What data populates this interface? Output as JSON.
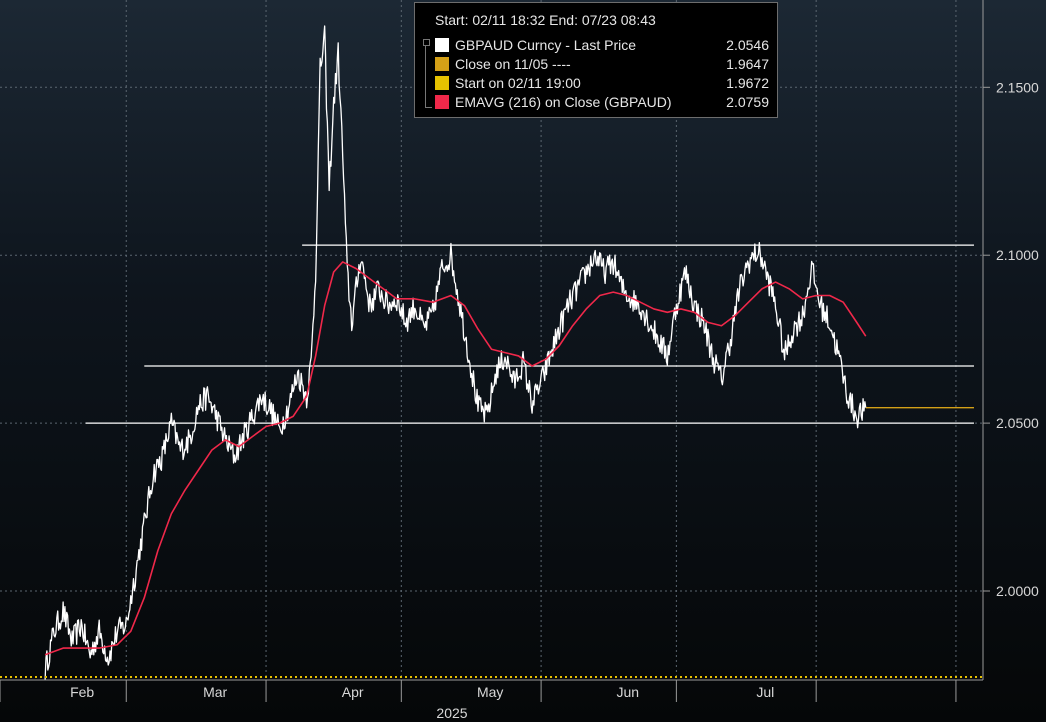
{
  "chart_data": {
    "type": "line",
    "title": "",
    "x_axis": {
      "month_labels": [
        "Feb",
        "Mar",
        "Apr",
        "May",
        "Jun",
        "Jul"
      ],
      "year_label": "2025",
      "range": [
        "2025-02-11",
        "2025-07-23"
      ]
    },
    "y_axis": {
      "ticks": [
        "2.1500",
        "2.1000",
        "2.0500",
        "2.0000"
      ],
      "range": [
        1.9735,
        2.176
      ],
      "side": "right"
    },
    "grid": true,
    "legend": {
      "placement": "top-center",
      "header": "Start: 02/11 18:32 End: 07/23 08:43",
      "entries": [
        {
          "name": "GBPAUD Curncy - Last Price",
          "value": "2.0546",
          "color": "#ffffff"
        },
        {
          "name": "Close on 11/05 ----",
          "value": "1.9647",
          "color": "#d4a017"
        },
        {
          "name": "Start on 02/11 19:00",
          "value": "1.9672",
          "color": "#e6c200"
        },
        {
          "name": "EMAVG (216)  on Close (GBPAUD)",
          "value": "2.0759",
          "color": "#f0284a"
        }
      ]
    },
    "series": [
      {
        "name": "GBPAUD Curncy - Last Price",
        "color": "#ffffff",
        "points": [
          [
            "2025-02-11",
            1.9765
          ],
          [
            "2025-02-13",
            1.988
          ],
          [
            "2025-02-15",
            1.994
          ],
          [
            "2025-02-17",
            1.985
          ],
          [
            "2025-02-19",
            1.99
          ],
          [
            "2025-02-21",
            1.981
          ],
          [
            "2025-02-23",
            1.988
          ],
          [
            "2025-02-25",
            1.98
          ],
          [
            "2025-02-27",
            1.988
          ],
          [
            "2025-03-01",
            1.99
          ],
          [
            "2025-03-03",
            2.005
          ],
          [
            "2025-03-05",
            2.02
          ],
          [
            "2025-03-07",
            2.035
          ],
          [
            "2025-03-09",
            2.04
          ],
          [
            "2025-03-11",
            2.05
          ],
          [
            "2025-03-13",
            2.042
          ],
          [
            "2025-03-15",
            2.045
          ],
          [
            "2025-03-17",
            2.055
          ],
          [
            "2025-03-19",
            2.058
          ],
          [
            "2025-03-21",
            2.052
          ],
          [
            "2025-03-23",
            2.045
          ],
          [
            "2025-03-25",
            2.04
          ],
          [
            "2025-03-27",
            2.046
          ],
          [
            "2025-03-29",
            2.052
          ],
          [
            "2025-03-31",
            2.058
          ],
          [
            "2025-04-02",
            2.054
          ],
          [
            "2025-04-04",
            2.048
          ],
          [
            "2025-04-06",
            2.055
          ],
          [
            "2025-04-08",
            2.065
          ],
          [
            "2025-04-10",
            2.058
          ],
          [
            "2025-04-11",
            2.068
          ],
          [
            "2025-04-12",
            2.095
          ],
          [
            "2025-04-13",
            2.155
          ],
          [
            "2025-04-14",
            2.165
          ],
          [
            "2025-04-15",
            2.12
          ],
          [
            "2025-04-16",
            2.145
          ],
          [
            "2025-04-17",
            2.16
          ],
          [
            "2025-04-18",
            2.13
          ],
          [
            "2025-04-19",
            2.095
          ],
          [
            "2025-04-20",
            2.08
          ],
          [
            "2025-04-22",
            2.1
          ],
          [
            "2025-04-24",
            2.085
          ],
          [
            "2025-04-26",
            2.09
          ],
          [
            "2025-04-28",
            2.085
          ],
          [
            "2025-04-30",
            2.087
          ],
          [
            "2025-05-02",
            2.08
          ],
          [
            "2025-05-04",
            2.085
          ],
          [
            "2025-05-06",
            2.078
          ],
          [
            "2025-05-08",
            2.083
          ],
          [
            "2025-05-10",
            2.096
          ],
          [
            "2025-05-12",
            2.1
          ],
          [
            "2025-05-14",
            2.085
          ],
          [
            "2025-05-16",
            2.07
          ],
          [
            "2025-05-18",
            2.055
          ],
          [
            "2025-05-20",
            2.052
          ],
          [
            "2025-05-22",
            2.065
          ],
          [
            "2025-05-24",
            2.07
          ],
          [
            "2025-05-26",
            2.062
          ],
          [
            "2025-05-28",
            2.068
          ],
          [
            "2025-05-30",
            2.056
          ],
          [
            "2025-06-01",
            2.062
          ],
          [
            "2025-06-03",
            2.07
          ],
          [
            "2025-06-05",
            2.078
          ],
          [
            "2025-06-07",
            2.085
          ],
          [
            "2025-06-09",
            2.09
          ],
          [
            "2025-06-11",
            2.095
          ],
          [
            "2025-06-13",
            2.1
          ],
          [
            "2025-06-15",
            2.095
          ],
          [
            "2025-06-17",
            2.098
          ],
          [
            "2025-06-19",
            2.09
          ],
          [
            "2025-06-21",
            2.087
          ],
          [
            "2025-06-23",
            2.085
          ],
          [
            "2025-06-25",
            2.08
          ],
          [
            "2025-06-27",
            2.075
          ],
          [
            "2025-06-29",
            2.07
          ],
          [
            "2025-07-01",
            2.085
          ],
          [
            "2025-07-03",
            2.095
          ],
          [
            "2025-07-05",
            2.085
          ],
          [
            "2025-07-07",
            2.08
          ],
          [
            "2025-07-09",
            2.07
          ],
          [
            "2025-07-11",
            2.063
          ],
          [
            "2025-07-13",
            2.075
          ],
          [
            "2025-07-15",
            2.09
          ],
          [
            "2025-07-17",
            2.098
          ],
          [
            "2025-07-19",
            2.101
          ],
          [
            "2025-07-20",
            2.099
          ],
          [
            "2025-07-21",
            2.094
          ],
          [
            "2025-07-22",
            2.09
          ],
          [
            "2025-07-23",
            2.085
          ],
          [
            "2025-07-25",
            2.07
          ],
          [
            "2025-07-27",
            2.078
          ],
          [
            "2025-07-29",
            2.082
          ],
          [
            "2025-07-31",
            2.096
          ],
          [
            "2025-08-02",
            2.085
          ],
          [
            "2025-08-04",
            2.08
          ],
          [
            "2025-08-06",
            2.07
          ],
          [
            "2025-08-08",
            2.058
          ],
          [
            "2025-08-10",
            2.052
          ],
          [
            "2025-08-12",
            2.0546
          ]
        ]
      },
      {
        "name": "EMAVG (216)  on Close (GBPAUD)",
        "color": "#f0284a",
        "points": [
          [
            "2025-02-11",
            1.981
          ],
          [
            "2025-02-15",
            1.983
          ],
          [
            "2025-02-19",
            1.983
          ],
          [
            "2025-02-23",
            1.983
          ],
          [
            "2025-02-27",
            1.984
          ],
          [
            "2025-03-02",
            1.988
          ],
          [
            "2025-03-05",
            1.998
          ],
          [
            "2025-03-08",
            2.012
          ],
          [
            "2025-03-11",
            2.023
          ],
          [
            "2025-03-14",
            2.03
          ],
          [
            "2025-03-17",
            2.036
          ],
          [
            "2025-03-20",
            2.042
          ],
          [
            "2025-03-23",
            2.045
          ],
          [
            "2025-03-26",
            2.043
          ],
          [
            "2025-03-29",
            2.046
          ],
          [
            "2025-04-01",
            2.049
          ],
          [
            "2025-04-04",
            2.05
          ],
          [
            "2025-04-07",
            2.052
          ],
          [
            "2025-04-10",
            2.058
          ],
          [
            "2025-04-12",
            2.07
          ],
          [
            "2025-04-14",
            2.085
          ],
          [
            "2025-04-16",
            2.095
          ],
          [
            "2025-04-18",
            2.098
          ],
          [
            "2025-04-21",
            2.096
          ],
          [
            "2025-04-24",
            2.093
          ],
          [
            "2025-04-27",
            2.09
          ],
          [
            "2025-04-30",
            2.087
          ],
          [
            "2025-05-04",
            2.087
          ],
          [
            "2025-05-08",
            2.086
          ],
          [
            "2025-05-12",
            2.088
          ],
          [
            "2025-05-15",
            2.085
          ],
          [
            "2025-05-18",
            2.078
          ],
          [
            "2025-05-21",
            2.072
          ],
          [
            "2025-05-24",
            2.071
          ],
          [
            "2025-05-27",
            2.07
          ],
          [
            "2025-05-30",
            2.067
          ],
          [
            "2025-06-02",
            2.069
          ],
          [
            "2025-06-05",
            2.073
          ],
          [
            "2025-06-08",
            2.079
          ],
          [
            "2025-06-11",
            2.084
          ],
          [
            "2025-06-14",
            2.088
          ],
          [
            "2025-06-17",
            2.089
          ],
          [
            "2025-06-20",
            2.088
          ],
          [
            "2025-06-23",
            2.086
          ],
          [
            "2025-06-26",
            2.084
          ],
          [
            "2025-06-29",
            2.083
          ],
          [
            "2025-07-02",
            2.084
          ],
          [
            "2025-07-05",
            2.083
          ],
          [
            "2025-07-08",
            2.08
          ],
          [
            "2025-07-11",
            2.079
          ],
          [
            "2025-07-14",
            2.082
          ],
          [
            "2025-07-17",
            2.086
          ],
          [
            "2025-07-20",
            2.09
          ],
          [
            "2025-07-23",
            2.092
          ],
          [
            "2025-07-26",
            2.09
          ],
          [
            "2025-07-29",
            2.087
          ],
          [
            "2025-08-01",
            2.088
          ],
          [
            "2025-08-04",
            2.088
          ],
          [
            "2025-08-07",
            2.086
          ],
          [
            "2025-08-10",
            2.08
          ],
          [
            "2025-08-12",
            2.0759
          ]
        ]
      }
    ],
    "reference_lines": [
      {
        "y": 2.103,
        "from": "2025-04-09",
        "to": "2025-09-05",
        "color": "#ffffff"
      },
      {
        "y": 2.067,
        "from": "2025-03-05",
        "to": "2025-09-05",
        "color": "#ffffff"
      },
      {
        "y": 2.05,
        "from": "2025-02-20",
        "to": "2025-09-05",
        "color": "#ffffff"
      },
      {
        "y": 2.0546,
        "from": "2025-08-12",
        "to": "2025-09-05",
        "color": "#d4a017"
      }
    ]
  }
}
